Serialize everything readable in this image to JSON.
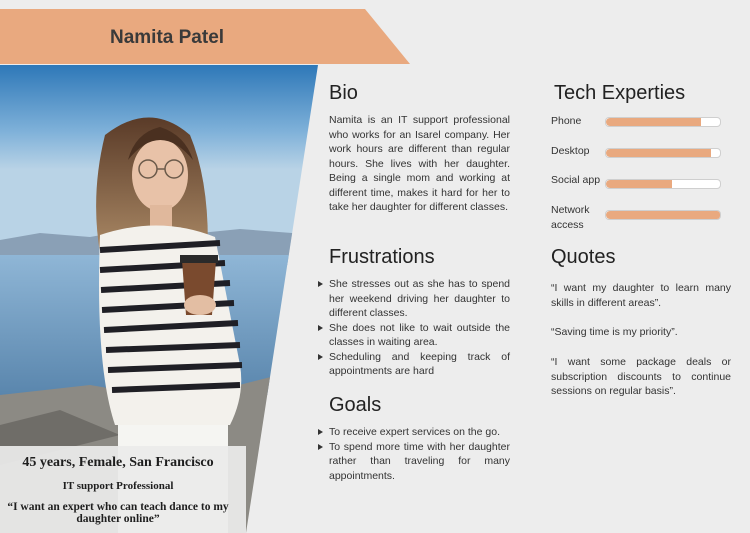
{
  "header": {
    "name": "Namita Patel"
  },
  "caption": {
    "line1": "45 years,  Female, San Francisco",
    "line2": "IT support Professional",
    "line3": "“I want an expert who can teach dance to my daughter online”"
  },
  "bio": {
    "heading": "Bio",
    "text": "Namita is an IT support professional who works for an Isarel company. Her work hours are different than regular hours. She lives with her daughter. Being a single mom and working at different time, makes it hard for her to take her daughter for different classes."
  },
  "frustrations": {
    "heading": "Frustrations",
    "items": [
      "She stresses out as she has to spend her weekend driving her daughter to different classes.",
      "She does not like to wait outside the classes in waiting area.",
      "Scheduling and keeping track of appointments are hard"
    ]
  },
  "goals": {
    "heading": "Goals",
    "items": [
      "To receive expert services on the go.",
      "To spend more time with her daughter rather than traveling for many appointments."
    ]
  },
  "tech": {
    "heading": "Tech Experties",
    "skills": [
      {
        "label": "Phone",
        "level": 0.83
      },
      {
        "label": "Desktop",
        "level": 0.92
      },
      {
        "label": "Social app",
        "level": 0.58
      },
      {
        "label": "Network access",
        "level": 1.0
      }
    ]
  },
  "quotes": {
    "heading": "Quotes",
    "items": [
      "“I want my daughter to learn many skills in different areas”.",
      "“Saving time is my priority”.",
      "“I want some package deals or subscription discounts to continue sessions on regular basis”."
    ]
  },
  "colors": {
    "accent": "#e9a97f",
    "background": "#ededed"
  }
}
